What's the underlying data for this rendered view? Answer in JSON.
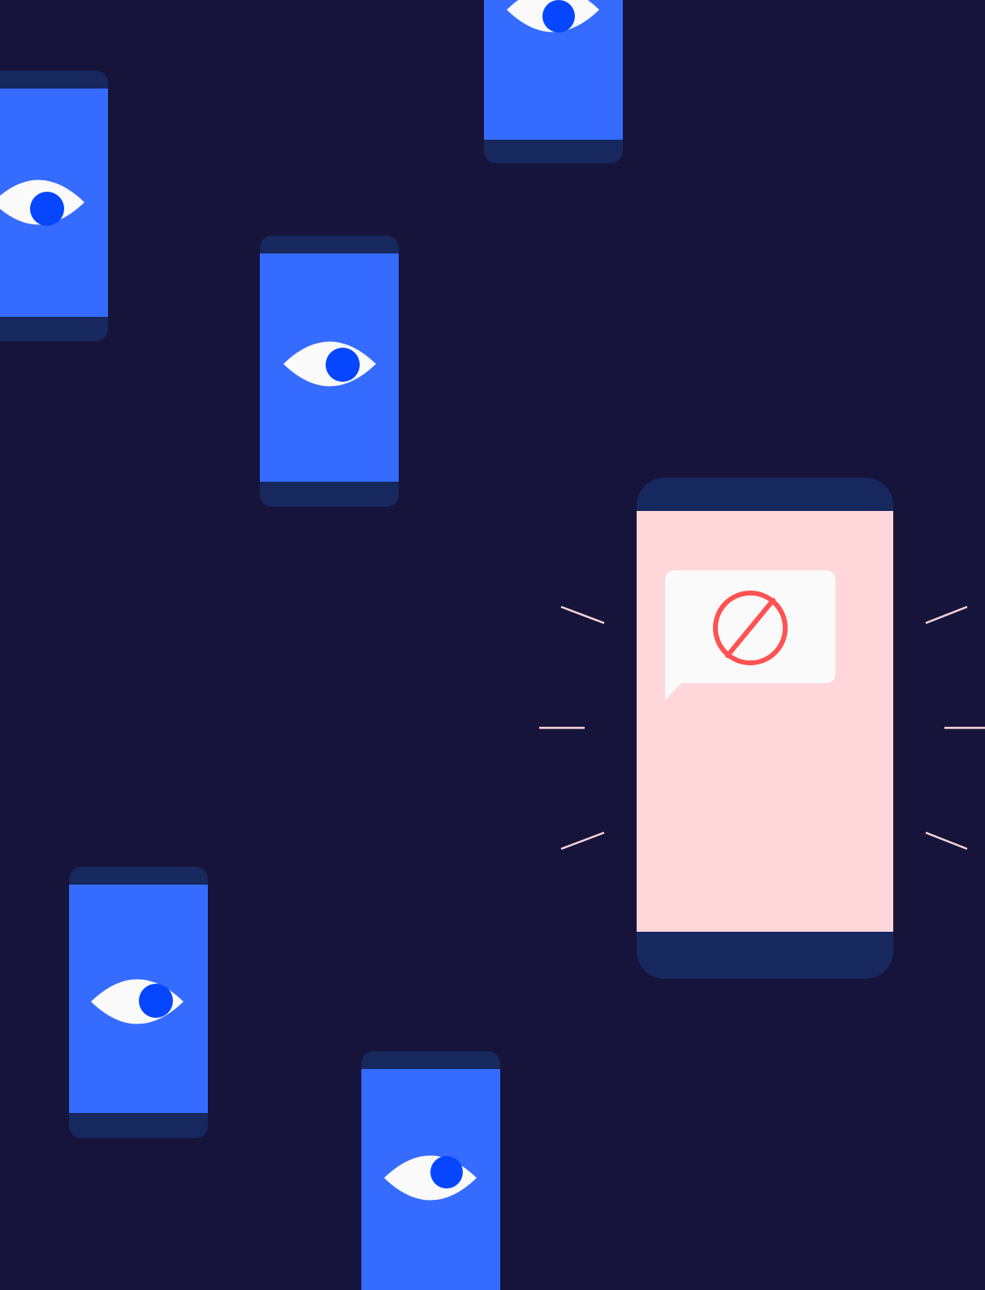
{
  "illustration": {
    "theme": "surveillance phones with a blocked message",
    "colors": {
      "background": "#16143a",
      "phone_frame": "#16285e",
      "phone_screen_watching": "#356cff",
      "phone_screen_blocked": "#ffd6da",
      "eye_white": "#fafafa",
      "pupil": "#0746ff",
      "speech_bubble": "#fafafa",
      "block_symbol": "#ff5252",
      "vibration_lines": "#ffd6da"
    },
    "icons": {
      "watching_phone": "eye-icon",
      "blocked_phone": "prohibited-icon",
      "message": "speech-bubble-icon"
    },
    "watching_phone_count": 5,
    "blocked_phone_count": 1
  }
}
